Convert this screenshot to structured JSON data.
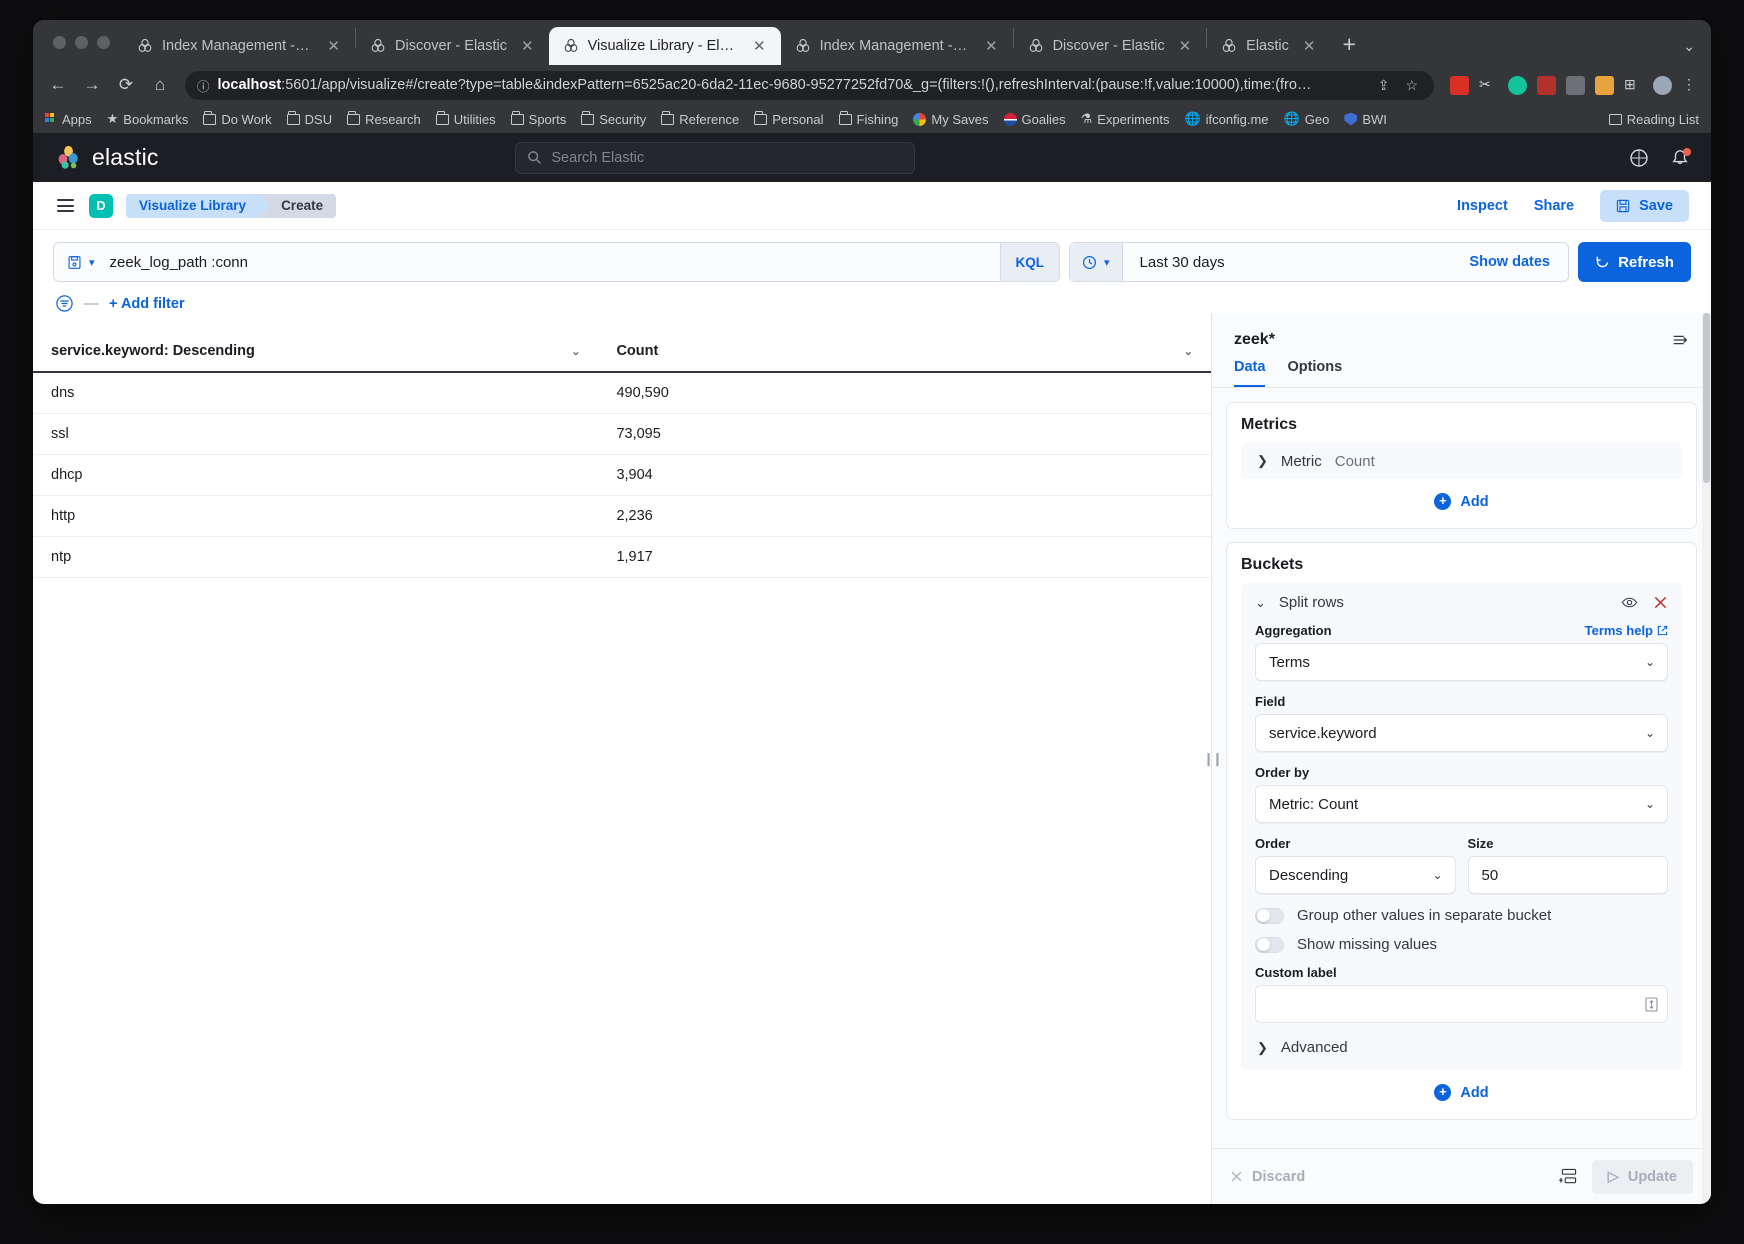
{
  "browser": {
    "tabs": [
      {
        "title": "Index Management - Elastic",
        "active": false
      },
      {
        "title": "Discover - Elastic",
        "active": false
      },
      {
        "title": "Visualize Library - Elastic",
        "active": true
      },
      {
        "title": "Index Management - Elastic",
        "active": false
      },
      {
        "title": "Discover - Elastic",
        "active": false
      },
      {
        "title": "Elastic",
        "active": false
      }
    ],
    "close_label": "✕",
    "new_tab_label": "+",
    "window_menu_label": "⌄",
    "nav": {
      "back": "←",
      "forward": "→",
      "reload": "⟳",
      "home": "⌂"
    },
    "url_host": "localhost",
    "url_rest": ":5601/app/visualize#/create?type=table&indexPattern=6525ac20-6da2-11ec-9680-95277252fd70&_g=(filters:!(),refreshInterval:(pause:!f,value:10000),time:(fro…",
    "share_icon": "share-icon",
    "bookmark_icon": "star-icon",
    "bookmarks": [
      {
        "label": "Apps",
        "icon": "apps-grid-icon"
      },
      {
        "label": "Bookmarks",
        "icon": "star-icon"
      },
      {
        "label": "Do Work",
        "icon": "folder-icon"
      },
      {
        "label": "DSU",
        "icon": "folder-icon"
      },
      {
        "label": "Research",
        "icon": "folder-icon"
      },
      {
        "label": "Utilities",
        "icon": "folder-icon"
      },
      {
        "label": "Sports",
        "icon": "folder-icon"
      },
      {
        "label": "Security",
        "icon": "folder-icon"
      },
      {
        "label": "Reference",
        "icon": "folder-icon"
      },
      {
        "label": "Personal",
        "icon": "folder-icon"
      },
      {
        "label": "Fishing",
        "icon": "folder-icon"
      },
      {
        "label": "My Saves",
        "icon": "google-icon"
      },
      {
        "label": "Goalies",
        "icon": "pepsi-icon"
      },
      {
        "label": "Experiments",
        "icon": "flask-icon"
      },
      {
        "label": "ifconfig.me",
        "icon": "globe-icon"
      },
      {
        "label": "Geo",
        "icon": "globe-icon"
      },
      {
        "label": "BWI",
        "icon": "shield-icon"
      }
    ],
    "reading_list": "Reading List"
  },
  "kibana": {
    "brand": "elastic",
    "search_placeholder": "Search Elastic",
    "space_initial": "D",
    "breadcrumbs": [
      {
        "label": "Visualize Library"
      },
      {
        "label": "Create"
      }
    ],
    "header_actions": {
      "inspect": "Inspect",
      "share": "Share",
      "save": "Save"
    }
  },
  "query": {
    "value": "zeek_log_path :conn",
    "language_badge": "KQL",
    "time_range": "Last 30 days",
    "show_dates": "Show dates",
    "refresh": "Refresh",
    "add_filter": "+ Add filter"
  },
  "chart_data": {
    "type": "table",
    "title": "",
    "columns": [
      "service.keyword: Descending",
      "Count"
    ],
    "categories": [
      "dns",
      "ssl",
      "dhcp",
      "http",
      "ntp"
    ],
    "values": [
      490590,
      73095,
      3904,
      2236,
      1917
    ],
    "rows": [
      {
        "key": "dns",
        "count": "490,590"
      },
      {
        "key": "ssl",
        "count": "73,095"
      },
      {
        "key": "dhcp",
        "count": "3,904"
      },
      {
        "key": "http",
        "count": "2,236"
      },
      {
        "key": "ntp",
        "count": "1,917"
      }
    ]
  },
  "editor": {
    "index_pattern": "zeek*",
    "tabs": [
      {
        "label": "Data",
        "active": true
      },
      {
        "label": "Options",
        "active": false
      }
    ],
    "metrics": {
      "title": "Metrics",
      "rows": [
        {
          "label": "Metric",
          "value": "Count"
        }
      ],
      "add_label": "Add"
    },
    "buckets": {
      "title": "Buckets",
      "bucket_name": "Split rows",
      "aggregation_label": "Aggregation",
      "aggregation_help": "Terms help",
      "aggregation_value": "Terms",
      "field_label": "Field",
      "field_value": "service.keyword",
      "order_by_label": "Order by",
      "order_by_value": "Metric: Count",
      "order_label": "Order",
      "order_value": "Descending",
      "size_label": "Size",
      "size_value": "50",
      "group_other_label": "Group other values in separate bucket",
      "show_missing_label": "Show missing values",
      "custom_label_label": "Custom label",
      "custom_label_value": "",
      "advanced_label": "Advanced",
      "add_label": "Add"
    },
    "footer": {
      "discard": "Discard",
      "update": "Update"
    }
  },
  "colors": {
    "accent": "#0b64dd",
    "elastic_teal": "#00bfb3",
    "danger": "#bd271e",
    "chrome_dark": "#35363a",
    "kibana_header": "#1d1e24"
  }
}
